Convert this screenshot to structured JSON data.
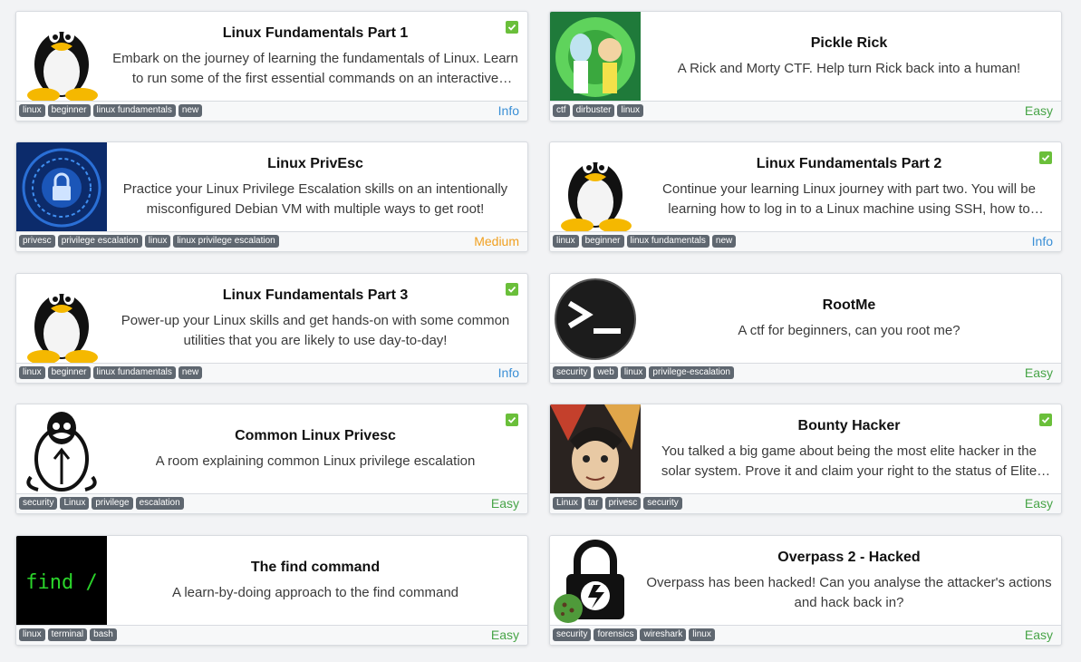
{
  "colors": {
    "info": "#3a8fd6",
    "easy": "#47a447",
    "medium": "#f0a020",
    "tag_bg": "#5f6770",
    "check": "#6abf3a"
  },
  "rooms": [
    {
      "title": "Linux Fundamentals Part 1",
      "description": "Embark on the journey of learning the fundamentals of Linux. Learn to run some of the first essential commands on an interactive terminal.",
      "tags": [
        "linux",
        "beginner",
        "linux fundamentals",
        "new"
      ],
      "difficulty": "Info",
      "completed": true,
      "icon": "tux-penguin"
    },
    {
      "title": "Pickle Rick",
      "description": "A Rick and Morty CTF. Help turn Rick back into a human!",
      "tags": [
        "ctf",
        "dirbuster",
        "linux"
      ],
      "difficulty": "Easy",
      "completed": false,
      "icon": "rick-and-morty"
    },
    {
      "title": "Linux PrivEsc",
      "description": "Practice your Linux Privilege Escalation skills on an intentionally misconfigured Debian VM with multiple ways to get root!",
      "tags": [
        "privesc",
        "privilege escalation",
        "linux",
        "linux privilege escalation"
      ],
      "difficulty": "Medium",
      "completed": false,
      "icon": "digital-lock"
    },
    {
      "title": "Linux Fundamentals Part 2",
      "description": "Continue your learning Linux journey with part two. You will be learning how to log in to a Linux machine using SSH, how to advance your commands.",
      "tags": [
        "linux",
        "beginner",
        "linux fundamentals",
        "new"
      ],
      "difficulty": "Info",
      "completed": true,
      "icon": "tux-penguin"
    },
    {
      "title": "Linux Fundamentals Part 3",
      "description": "Power-up your Linux skills and get hands-on with some common utilities that you are likely to use day-to-day!",
      "tags": [
        "linux",
        "beginner",
        "linux fundamentals",
        "new"
      ],
      "difficulty": "Info",
      "completed": true,
      "icon": "tux-penguin"
    },
    {
      "title": "RootMe",
      "description": "A ctf for beginners, can you root me?",
      "tags": [
        "security",
        "web",
        "linux",
        "privilege-escalation"
      ],
      "difficulty": "Easy",
      "completed": false,
      "icon": "terminal-prompt"
    },
    {
      "title": "Common Linux Privesc",
      "description": "A room explaining common Linux privilege escalation",
      "tags": [
        "security",
        "Linux",
        "privilege",
        "escalation"
      ],
      "difficulty": "Easy",
      "completed": true,
      "icon": "tux-outline-arrow"
    },
    {
      "title": "Bounty Hacker",
      "description": "You talked a big game about being the most elite hacker in the solar system. Prove it and claim your right to the status of Elite Bounty Hacker!",
      "tags": [
        "Linux",
        "tar",
        "privesc",
        "security"
      ],
      "difficulty": "Easy",
      "completed": true,
      "icon": "anime-crew"
    },
    {
      "title": "The find command",
      "description": "A learn-by-doing approach to the find command",
      "tags": [
        "linux",
        "terminal",
        "bash"
      ],
      "difficulty": "Easy",
      "completed": false,
      "icon": "find-terminal",
      "thumb_text": "find /"
    },
    {
      "title": "Overpass 2 - Hacked",
      "description": "Overpass has been hacked! Can you analyse the attacker's actions and hack back in?",
      "tags": [
        "security",
        "forensics",
        "wireshark",
        "linux"
      ],
      "difficulty": "Easy",
      "completed": false,
      "icon": "padlock-cookie"
    }
  ]
}
